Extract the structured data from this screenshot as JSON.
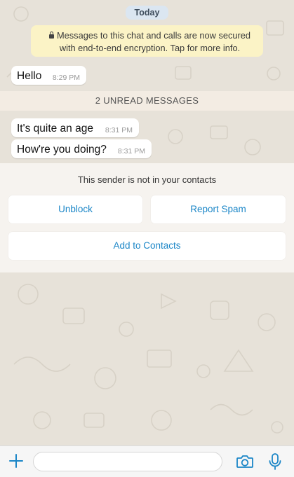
{
  "date_label": "Today",
  "encryption_notice": "Messages to this chat and calls are now secured with end-to-end encryption. Tap for more info.",
  "messages_before": [
    {
      "text": "Hello",
      "time": "8:29 PM"
    }
  ],
  "unread_banner": "2 UNREAD MESSAGES",
  "messages_after": [
    {
      "text": "It's quite an age",
      "time": "8:31 PM"
    },
    {
      "text": "How're you doing?",
      "time": "8:31 PM"
    }
  ],
  "sender_panel": {
    "title": "This sender is not in your contacts",
    "unblock_label": "Unblock",
    "report_label": "Report Spam",
    "add_label": "Add to Contacts"
  },
  "composer": {
    "placeholder": "",
    "icons": [
      "plus-icon",
      "camera-icon",
      "microphone-icon"
    ]
  },
  "colors": {
    "accent": "#1b86c7",
    "wallpaper": "#e7e2d9",
    "encryption_bg": "#fbf3c6",
    "date_pill_bg": "#dbe6f1"
  }
}
